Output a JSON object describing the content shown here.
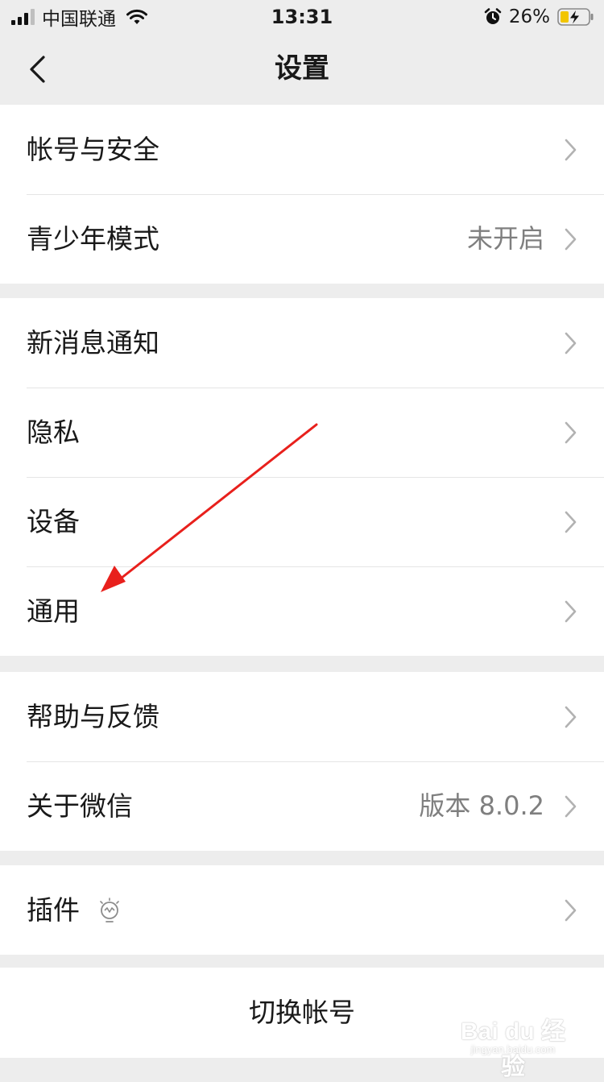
{
  "status_bar": {
    "carrier": "中国联通",
    "time": "13:31",
    "battery": "26%",
    "icons": [
      "signal-icon",
      "wifi-icon",
      "alarm-icon",
      "battery-charging-icon"
    ]
  },
  "nav": {
    "title": "设置",
    "back_icon": "back-chevron-icon"
  },
  "groups": {
    "g1": {
      "account_security": "帐号与安全",
      "teen_mode": "青少年模式",
      "teen_mode_value": "未开启"
    },
    "g2": {
      "new_message": "新消息通知",
      "privacy": "隐私",
      "devices": "设备",
      "general": "通用"
    },
    "g3": {
      "help": "帮助与反馈",
      "about": "关于微信",
      "about_value": "版本 8.0.2"
    },
    "g4": {
      "plugins": "插件",
      "plugins_icon": "lightbulb-icon"
    }
  },
  "switch_account": "切换帐号",
  "watermark": {
    "text": "Bai du 经验",
    "sub": "jingyan.baidu.com"
  },
  "colors": {
    "background": "#ededed",
    "row": "#ffffff",
    "text": "#191919",
    "secondary": "#7f7f7f",
    "chevron": "#b2b2b2",
    "annotation_arrow": "#e8201c",
    "battery_fill": "#f2c500"
  }
}
